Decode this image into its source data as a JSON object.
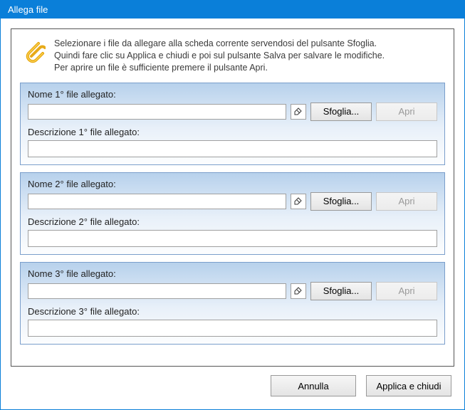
{
  "titlebar": "Allega file",
  "intro": {
    "line1": "Selezionare i file da allegare alla scheda corrente servendosi del pulsante Sfoglia.",
    "line2": "Quindi fare clic su Applica e chiudi e poi sul pulsante Salva per salvare le modifiche.",
    "line3": "Per aprire un file è sufficiente premere il pulsante Apri."
  },
  "groups": [
    {
      "name_label": "Nome 1° file allegato:",
      "browse_label": "Sfoglia...",
      "open_label": "Apri",
      "desc_label": "Descrizione 1° file allegato:",
      "name_value": "",
      "desc_value": ""
    },
    {
      "name_label": "Nome 2° file allegato:",
      "browse_label": "Sfoglia...",
      "open_label": "Apri",
      "desc_label": "Descrizione 2° file allegato:",
      "name_value": "",
      "desc_value": ""
    },
    {
      "name_label": "Nome 3° file allegato:",
      "browse_label": "Sfoglia...",
      "open_label": "Apri",
      "desc_label": "Descrizione 3° file allegato:",
      "name_value": "",
      "desc_value": ""
    }
  ],
  "footer": {
    "cancel": "Annulla",
    "apply_close": "Applica e chiudi"
  },
  "icons": {
    "paperclip": "paperclip-icon",
    "eraser": "eraser-icon"
  }
}
